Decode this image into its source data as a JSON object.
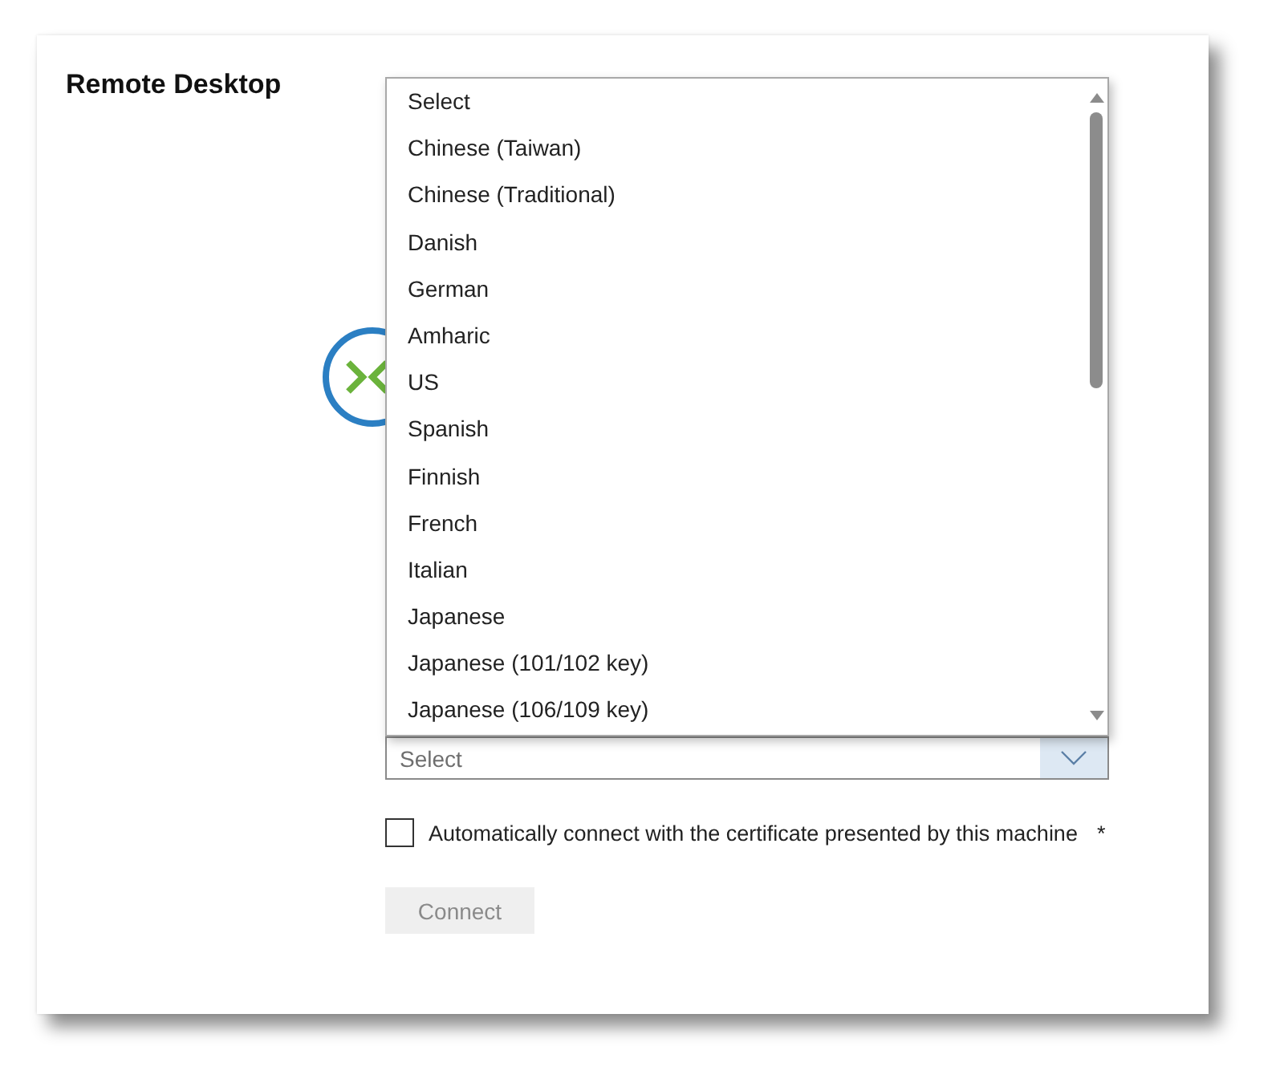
{
  "window": {
    "title": "Remote Desktop"
  },
  "dropdown": {
    "open": true,
    "options": [
      {
        "label": "Select",
        "selected": false
      },
      {
        "label": "Chinese (Taiwan)",
        "selected": false
      },
      {
        "label": "Chinese (Traditional)",
        "selected": false
      },
      {
        "label": "Danish",
        "selected": false
      },
      {
        "label": "German",
        "selected": false
      },
      {
        "label": "Amharic",
        "selected": false
      },
      {
        "label": "US",
        "selected": false
      },
      {
        "label": "Spanish",
        "selected": false
      },
      {
        "label": "Finnish",
        "selected": false
      },
      {
        "label": "French",
        "selected": false
      },
      {
        "label": "Italian",
        "selected": false
      },
      {
        "label": "Japanese",
        "selected": false
      },
      {
        "label": "Japanese (101/102 key)",
        "selected": false
      },
      {
        "label": "Japanese (106/109 key)",
        "selected": false
      }
    ]
  },
  "keyboard_select": {
    "placeholder": "Select"
  },
  "auto_connect": {
    "label": "Automatically connect with the certificate presented by this machine",
    "required_mark": "*",
    "checked": false
  },
  "connect_button": {
    "label": "Connect",
    "disabled": true
  }
}
